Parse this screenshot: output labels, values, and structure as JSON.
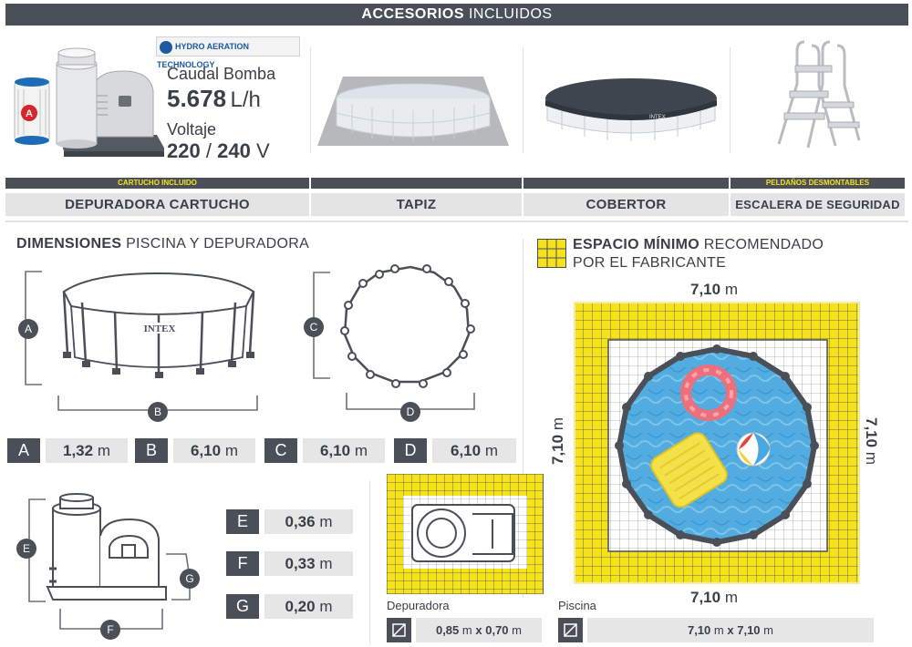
{
  "header": {
    "title_bold": "ACCESORIOS",
    "title_rest": " INCLUIDOS"
  },
  "pump": {
    "badge": "HYDRO AERATION TECHNOLOGY",
    "cartridge_mark": "A",
    "flow_label": "Caudal Bomba",
    "flow_value": "5.678",
    "flow_unit": "L/h",
    "voltage_label": "Voltaje",
    "voltage_value": "220",
    "voltage_sep": "/",
    "voltage_value2": "240",
    "voltage_unit": "V"
  },
  "pool_logo": "INTEX",
  "accessories": [
    {
      "tag": "CARTUCHO INCLUIDO",
      "label": "DEPURADORA CARTUCHO"
    },
    {
      "tag": "",
      "label": "TAPIZ"
    },
    {
      "tag": "",
      "label": "COBERTOR"
    },
    {
      "tag": "PELDAÑOS DESMONTABLES",
      "label": "ESCALERA DE SEGURIDAD"
    }
  ],
  "dimensions": {
    "title_bold": "DIMENSIONES",
    "title_rest": " PISCINA Y DEPURADORA",
    "pool": [
      {
        "key": "A",
        "value": "1,32",
        "unit": "m"
      },
      {
        "key": "B",
        "value": "6,10",
        "unit": "m"
      },
      {
        "key": "C",
        "value": "6,10",
        "unit": "m"
      },
      {
        "key": "D",
        "value": "6,10",
        "unit": "m"
      }
    ],
    "pump": [
      {
        "key": "E",
        "value": "0,36",
        "unit": "m"
      },
      {
        "key": "F",
        "value": "0,33",
        "unit": "m"
      },
      {
        "key": "G",
        "value": "0,20",
        "unit": "m"
      }
    ]
  },
  "space": {
    "title_bold": "ESPACIO MÍNIMO",
    "title_rest": " RECOMENDADO",
    "title_line2": "POR EL FABRICANTE",
    "top": "7,10",
    "bottom": "7,10",
    "left": "7,10",
    "right": "7,10",
    "unit": "m"
  },
  "footprints": {
    "pump_label": "Depuradora",
    "pump_w": "0,85",
    "pump_h": "0,70",
    "pool_label": "Piscina",
    "pool_w": "7,10",
    "pool_h": "7,10",
    "unit": "m",
    "times": "x"
  },
  "colors": {
    "dark": "#4a4f58",
    "yellow": "#f5e21b",
    "pale_yellow": "#f4ecaa",
    "water": "#4fa9e0",
    "gray_bg": "#e4e4e4"
  }
}
